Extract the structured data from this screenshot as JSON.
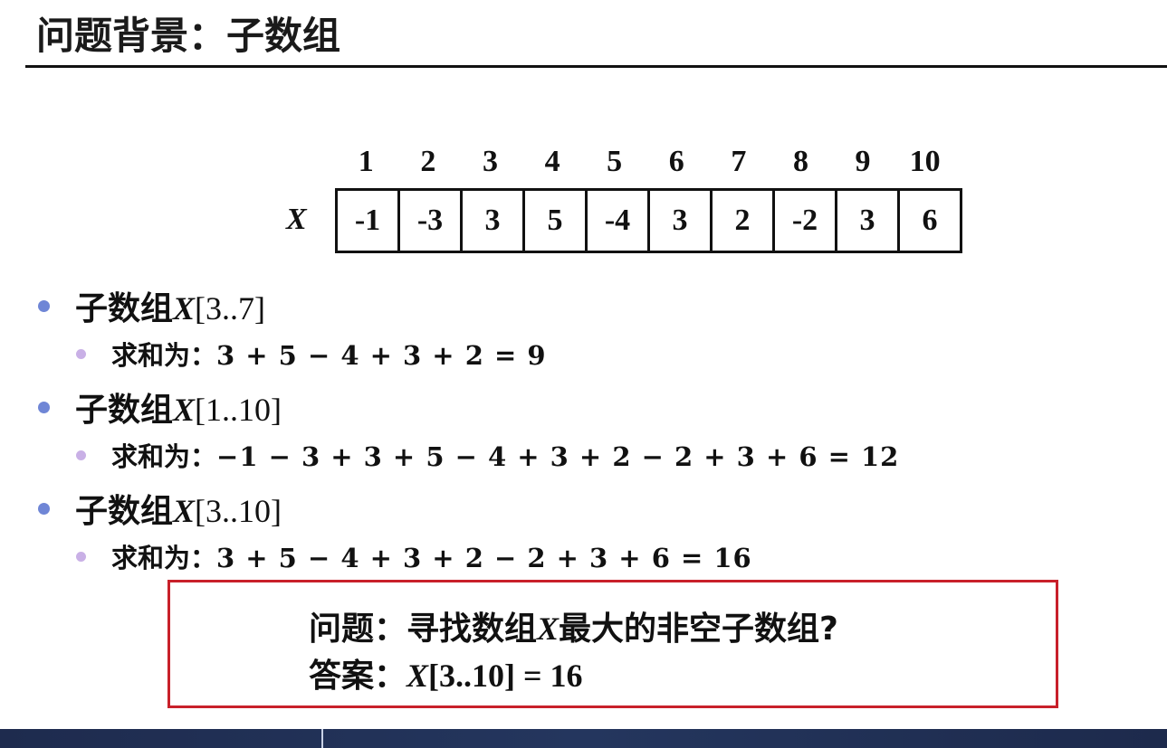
{
  "title": "问题背景：子数组",
  "array": {
    "label": "X",
    "indices": [
      "1",
      "2",
      "3",
      "4",
      "5",
      "6",
      "7",
      "8",
      "9",
      "10"
    ],
    "values": [
      "-1",
      "-3",
      "3",
      "5",
      "-4",
      "3",
      "2",
      "-2",
      "3",
      "6"
    ]
  },
  "items": [
    {
      "prefix": "子数组",
      "var": "X",
      "range": "[3..7]",
      "sum_label": "求和为：",
      "expr": "3 + 5 − 4 + 3 + 2 = 9"
    },
    {
      "prefix": "子数组",
      "var": "X",
      "range": "[1..10]",
      "sum_label": "求和为：",
      "expr": "−1 − 3 + 3 + 5 − 4 + 3 + 2 − 2 + 3 + 6 = 12"
    },
    {
      "prefix": "子数组",
      "var": "X",
      "range": "[3..10]",
      "sum_label": "求和为：",
      "expr": "3 + 5 − 4 + 3 + 2 − 2 + 3 + 6 = 16"
    }
  ],
  "question": {
    "q_label": "问题：",
    "q_text_a": "寻找数组",
    "q_var": "X",
    "q_text_b": "最大的非空子数组?",
    "a_label": "答案：",
    "a_var": "X",
    "a_text": "[3..10] = 16"
  },
  "colors": {
    "bullet1": "#6f86d6",
    "bullet2": "#c9b0e6",
    "box_border": "#c8202a"
  }
}
